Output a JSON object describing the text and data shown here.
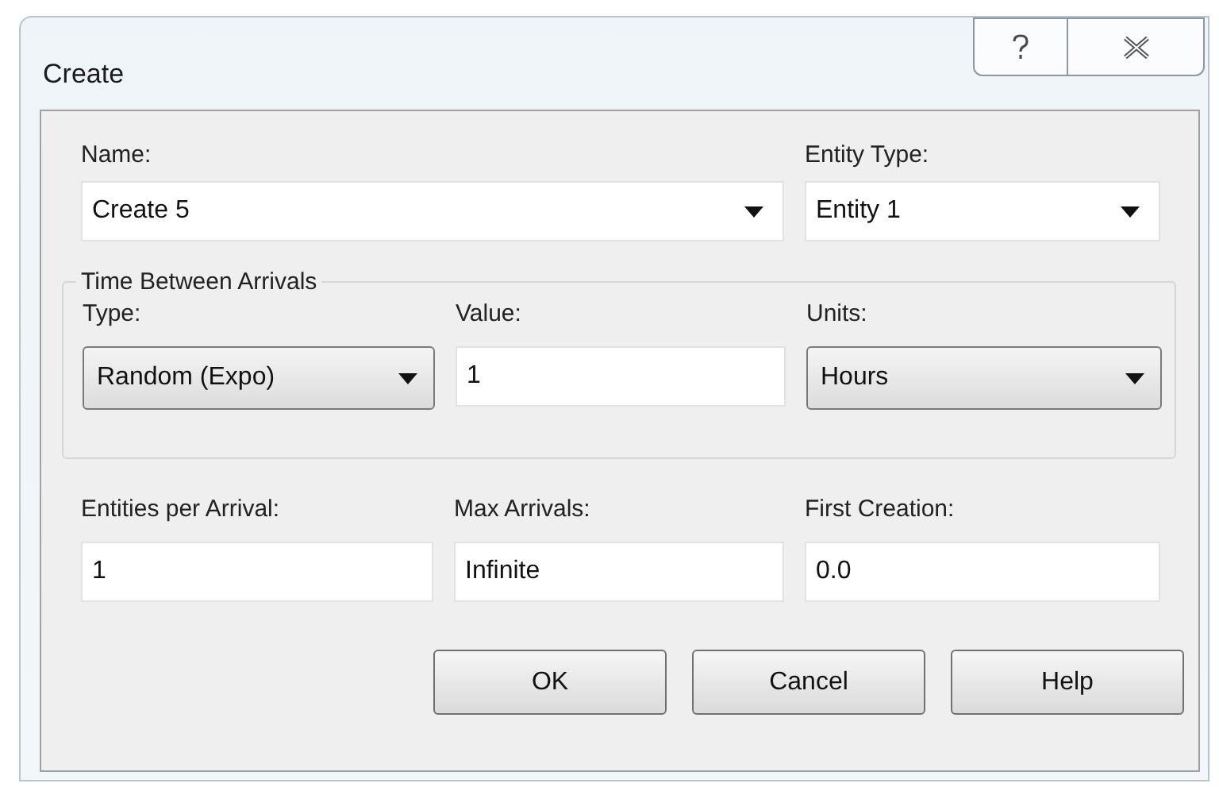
{
  "window": {
    "title": "Create"
  },
  "top_fields": [
    {
      "label": "Name:",
      "value": "Create 5",
      "kind": "editable_combo"
    },
    {
      "label": "Entity Type:",
      "value": "Entity 1",
      "kind": "editable_combo"
    }
  ],
  "time_between_arrivals": {
    "title": "Time Between Arrivals",
    "fields": [
      {
        "label": "Type:",
        "value": "Random (Expo)",
        "kind": "combo"
      },
      {
        "label": "Value:",
        "value": "1",
        "kind": "text"
      },
      {
        "label": "Units:",
        "value": "Hours",
        "kind": "combo"
      }
    ]
  },
  "fields": [
    {
      "label": "Entities per Arrival:",
      "value": "1",
      "kind": "text"
    },
    {
      "label": "Max Arrivals:",
      "value": "Infinite",
      "kind": "text"
    },
    {
      "label": "First Creation:",
      "value": "0.0",
      "kind": "text"
    }
  ],
  "buttons": [
    "OK",
    "Cancel",
    "Help"
  ]
}
